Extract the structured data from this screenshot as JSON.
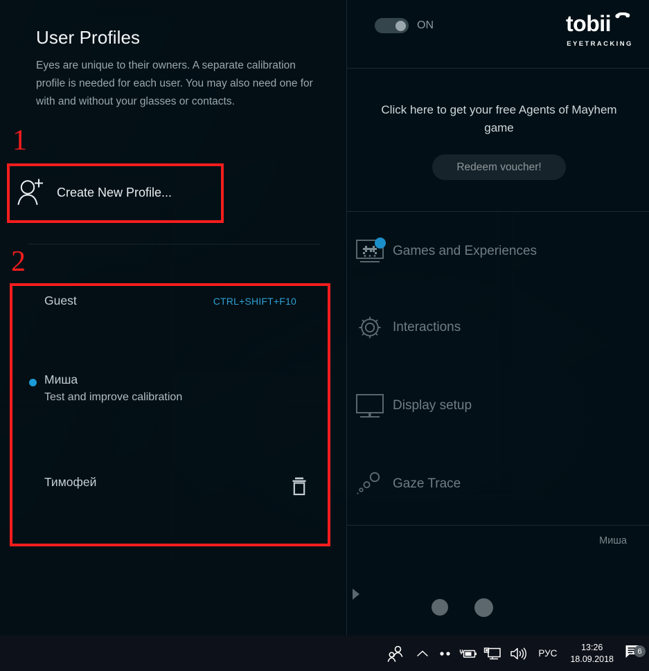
{
  "left": {
    "title": "User Profiles",
    "description": "Eyes are unique to their owners. A separate calibration profile is needed for each user. You may also need one for with and without your glasses or contacts.",
    "create_profile_label": "Create New Profile...",
    "create_profile_icon": "user-plus-icon",
    "profiles": [
      {
        "name": "Guest",
        "shortcut": "CTRL+SHIFT+F10",
        "subtitle": "",
        "selected": false,
        "deletable": false
      },
      {
        "name": "Миша",
        "shortcut": "",
        "subtitle": "Test and improve calibration",
        "selected": true,
        "deletable": false
      },
      {
        "name": "Тимофей",
        "shortcut": "",
        "subtitle": "",
        "selected": false,
        "deletable": true,
        "delete_icon": "trash-icon"
      }
    ]
  },
  "annotations": [
    {
      "number": "1",
      "target": "create-new-profile"
    },
    {
      "number": "2",
      "target": "profile-list"
    }
  ],
  "right": {
    "toggle": {
      "label": "ON",
      "state": "on"
    },
    "logo": {
      "word": "tobii",
      "tagline": "EYETRACKING"
    },
    "promo": {
      "text": "Click here to get your free Agents of Mayhem game",
      "button_label": "Redeem voucher!"
    },
    "nav": [
      {
        "label": "Games and Experiences",
        "icon": "game-screen-icon",
        "badge": true
      },
      {
        "label": "Interactions",
        "icon": "gear-icon",
        "badge": false
      },
      {
        "label": "Display setup",
        "icon": "monitor-icon",
        "badge": false
      },
      {
        "label": "Gaze Trace",
        "icon": "gaze-dots-icon",
        "badge": false
      }
    ],
    "footer": {
      "user": "Миша",
      "play_icon": "play-arrow-icon"
    }
  },
  "taskbar": {
    "icons": [
      {
        "name": "eyetracking-user-icon"
      },
      {
        "name": "show-hidden-icons-chevron"
      },
      {
        "name": "two-dots-icon"
      },
      {
        "name": "battery-charging-icon"
      },
      {
        "name": "network-display-icon"
      },
      {
        "name": "volume-icon"
      }
    ],
    "language": "РУС",
    "time": "13:26",
    "date": "18.09.2018",
    "notification_count": "6"
  },
  "colors": {
    "accent_blue": "#1b9bd8",
    "shortcut_blue": "#2f9fd4",
    "annotation_red": "#f41d1d",
    "panel_bg": "#021017"
  }
}
